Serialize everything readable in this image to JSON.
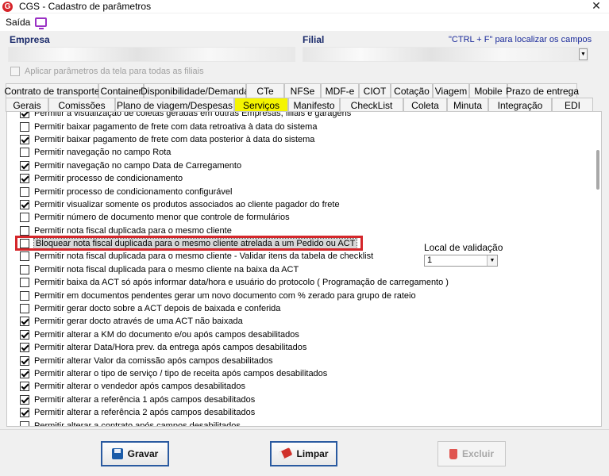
{
  "window": {
    "title": "CGS - Cadastro de parâmetros",
    "app_icon_letter": "G",
    "close_glyph": "✕"
  },
  "menu": {
    "saida": "Saída"
  },
  "header": {
    "empresa_label": "Empresa",
    "filial_label": "Filial",
    "shortcut_hint": "\"CTRL + F\" para localizar os campos",
    "apply_all_label": "Aplicar parâmetros da tela para todas as filiais"
  },
  "tabs_row1": [
    "Contrato de transporte",
    "Container",
    "Disponibilidade/Demanda",
    "CTe",
    "NFSe",
    "MDF-e",
    "CIOT",
    "Cotação",
    "Viagem",
    "Mobile",
    "Prazo de entrega"
  ],
  "tabs_row2": [
    "Gerais",
    "Comissões",
    "Plano de viagem/Despesas",
    "Serviços",
    "Manifesto",
    "CheckList",
    "Coleta",
    "Minuta",
    "Integração",
    "EDI"
  ],
  "active_tab": "Serviços",
  "rows": [
    {
      "label": "Permitir a visualização de coletas geradas em outras Empresas, filiais e garagens",
      "checked": true
    },
    {
      "label": "Permitir baixar pagamento de frete com data retroativa à data do sistema",
      "checked": false
    },
    {
      "label": "Permitir baixar pagamento de frete com data posterior à data do sistema",
      "checked": true
    },
    {
      "label": "Permitir navegação no campo Rota",
      "checked": false
    },
    {
      "label": "Permitir navegação no campo Data de Carregamento",
      "checked": true
    },
    {
      "label": "Permitir processo de condicionamento",
      "checked": true
    },
    {
      "label": "Permitir processo de condicionamento configurável",
      "checked": false
    },
    {
      "label": "Permitir visualizar somente os produtos associados ao cliente pagador do frete",
      "checked": true
    },
    {
      "label": "Permitir número de documento menor que controle de formulários",
      "checked": false
    },
    {
      "label": "Permitir nota fiscal duplicada para o mesmo cliente",
      "checked": false
    },
    {
      "label": "Bloquear nota fiscal duplicada para o mesmo cliente atrelada a um Pedido ou ACT",
      "checked": false
    },
    {
      "label": "Permitir nota fiscal duplicada para o mesmo cliente - Validar itens da tabela de checklist",
      "checked": false
    },
    {
      "label": "Permitir nota fiscal duplicada para o mesmo cliente na baixa da ACT",
      "checked": false
    },
    {
      "label": "Permitir baixa da ACT só após informar data/hora e usuário do protocolo ( Programação de carregamento )",
      "checked": false
    },
    {
      "label": "Permitir em documentos pendentes gerar um novo documento com % zerado para grupo de rateio",
      "checked": false
    },
    {
      "label": "Permitir gerar docto sobre a ACT depois de baixada e conferida",
      "checked": false
    },
    {
      "label": "Permitir gerar docto através de uma ACT não baixada",
      "checked": true
    },
    {
      "label": "Permitir alterar a KM do documento e/ou após campos desabilitados",
      "checked": true
    },
    {
      "label": "Permitir alterar Data/Hora prev. da entrega após campos desabilitados",
      "checked": true
    },
    {
      "label": "Permitir alterar Valor da comissão após campos desabilitados",
      "checked": true
    },
    {
      "label": "Permitir alterar o tipo de serviço / tipo de receita após campos desabilitados",
      "checked": true
    },
    {
      "label": "Permitir alterar o vendedor após campos desabilitados",
      "checked": true
    },
    {
      "label": "Permitir alterar a referência 1 após campos desabilitados",
      "checked": true
    },
    {
      "label": "Permitir alterar a referência 2 após campos desabilitados",
      "checked": true
    },
    {
      "label": "Permitir alterar a contrato após campos desabilitados",
      "checked": false
    }
  ],
  "highlighted_row_index": 10,
  "local_validacao": {
    "label": "Local de validação",
    "value": "1"
  },
  "buttons": {
    "gravar": "Gravar",
    "limpar": "Limpar",
    "excluir": "Excluir"
  }
}
